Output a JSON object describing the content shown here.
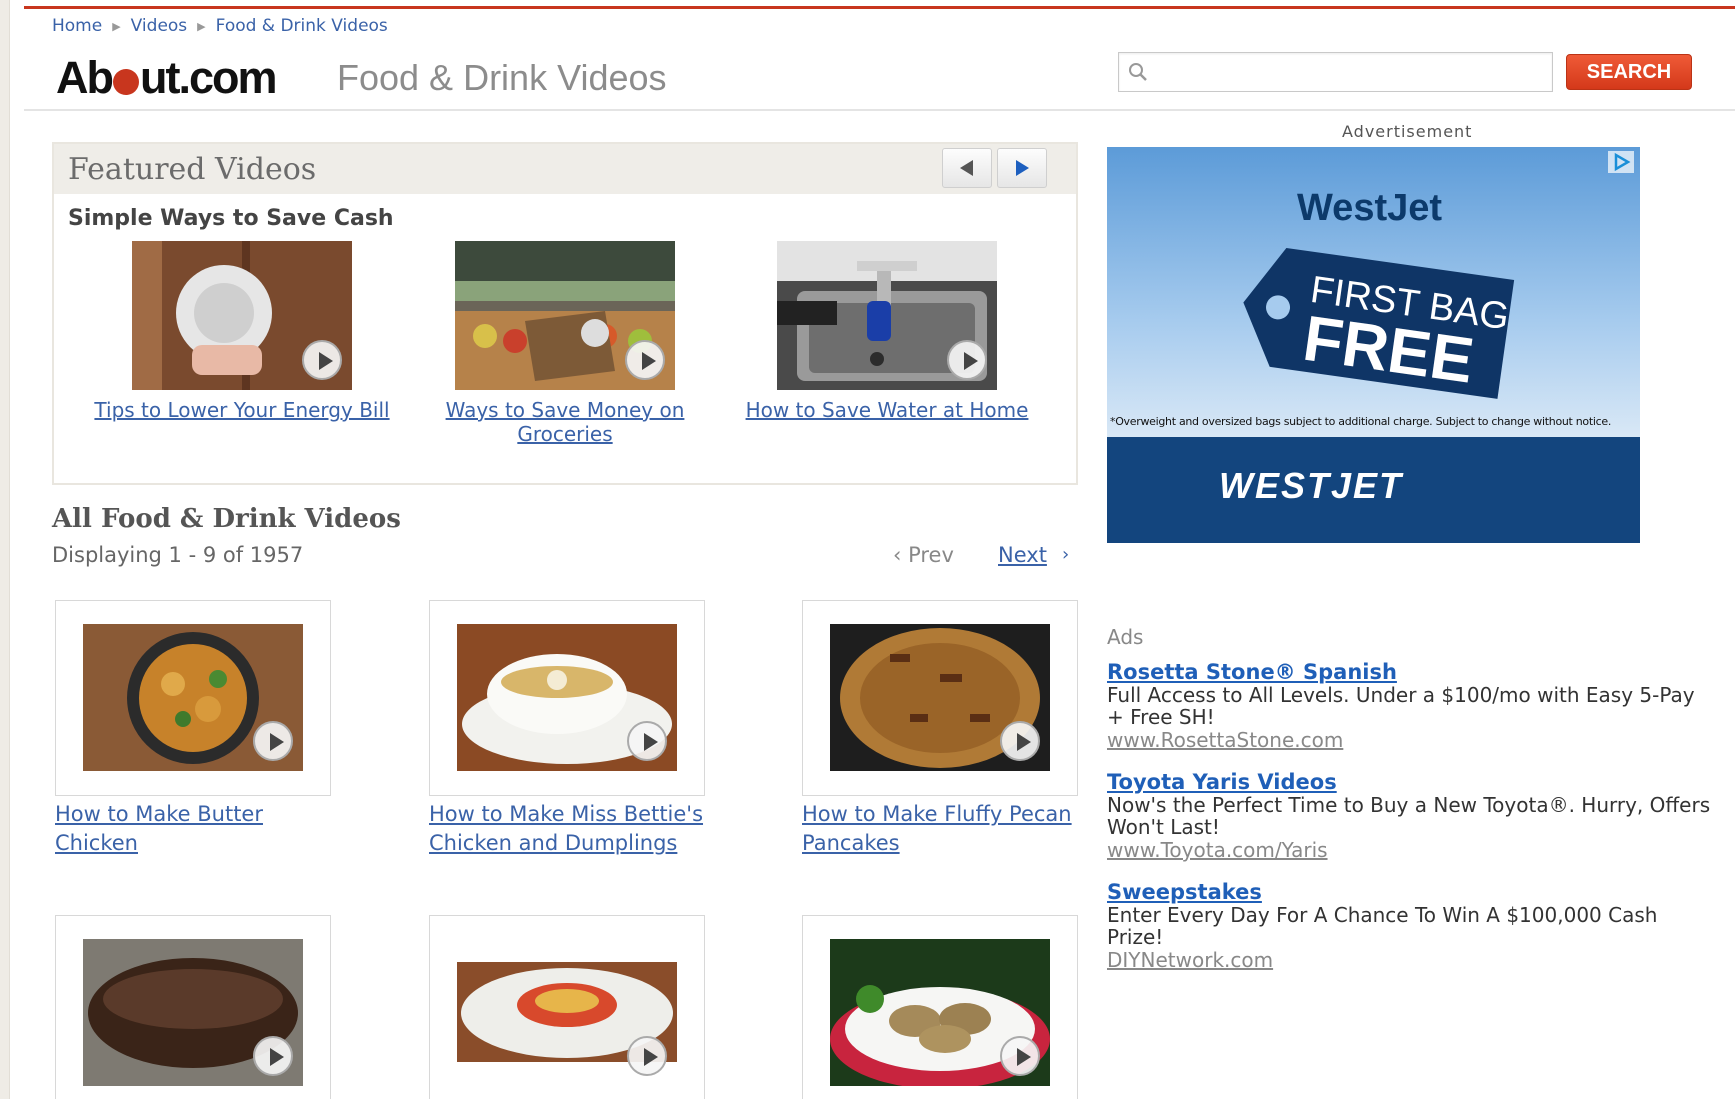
{
  "breadcrumb": {
    "home": "Home",
    "videos": "Videos",
    "current": "Food & Drink Videos"
  },
  "header": {
    "logo_pre": "Ab",
    "logo_post": "ut.com",
    "section_title": "Food & Drink Videos",
    "search_placeholder": "",
    "search_button": "SEARCH"
  },
  "featured": {
    "title": "Featured Videos",
    "subtitle": "Simple Ways to Save Cash",
    "items": [
      {
        "caption": "Tips to Lower Your Energy Bill"
      },
      {
        "caption": "Ways to Save Money on Groceries"
      },
      {
        "caption": "How to Save Water at Home"
      }
    ]
  },
  "all_videos": {
    "title": "All Food & Drink Videos",
    "displaying": "Displaying 1 - 9 of 1957",
    "prev": "Prev",
    "next": "Next",
    "items": [
      {
        "caption": "How to Make Butter Chicken"
      },
      {
        "caption": "How to Make Miss Bettie's Chicken and Dumplings"
      },
      {
        "caption": "How to Make Fluffy Pecan Pancakes"
      },
      {
        "caption": ""
      },
      {
        "caption": ""
      },
      {
        "caption": ""
      }
    ]
  },
  "advertisement": {
    "label": "Advertisement",
    "brand": "WestJet",
    "line1": "FIRST BAG",
    "line2": "FREE",
    "fine_print": "*Overweight and oversized bags subject to additional charge. Subject to change without notice.",
    "logo": "WESTJET"
  },
  "ads": {
    "label": "Ads",
    "items": [
      {
        "title": "Rosetta Stone® Spanish",
        "desc": "Full Access to All Levels. Under a $100/mo with Easy 5-Pay + Free SH!",
        "url": "www.RosettaStone.com"
      },
      {
        "title": "Toyota Yaris Videos",
        "desc": "Now's the Perfect Time to Buy a New Toyota®. Hurry, Offers Won't Last!",
        "url": "www.Toyota.com/Yaris"
      },
      {
        "title": "Sweepstakes",
        "desc": "Enter Every Day For A Chance To Win A $100,000 Cash Prize!",
        "url": "DIYNetwork.com"
      }
    ]
  }
}
